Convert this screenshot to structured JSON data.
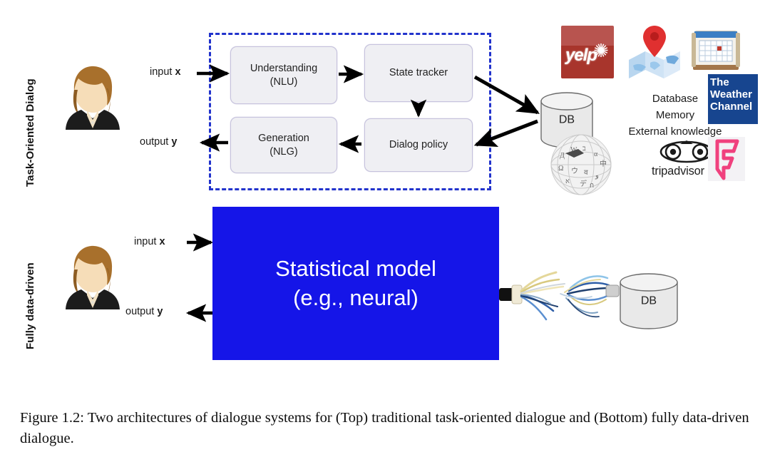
{
  "figure": {
    "rows": {
      "top_label": "Task-Oriented Dialog",
      "bottom_label": "Fully data-driven"
    },
    "io": {
      "input_label": "input ",
      "input_var": "x",
      "output_label": "output ",
      "output_var": "y"
    },
    "pipeline_boxes": [
      {
        "id": "nlu",
        "line1": "Understanding",
        "line2": "(NLU)"
      },
      {
        "id": "state",
        "line1": "State tracker",
        "line2": ""
      },
      {
        "id": "policy",
        "line1": "Dialog policy",
        "line2": ""
      },
      {
        "id": "nlg",
        "line1": "Generation",
        "line2": "(NLG)"
      }
    ],
    "model_box": {
      "line1": "Statistical model",
      "line2": "(e.g., neural)",
      "color": "#1515e8"
    },
    "databases": {
      "top_label": "DB",
      "bottom_label": "DB"
    },
    "knowledge_sources": {
      "line1": "Database",
      "line2": "Memory",
      "line3": "External knowledge"
    },
    "logos": {
      "yelp": "yelp",
      "maps": "map-pin-icon",
      "calendar": "calendar-icon",
      "weather": {
        "line1": "The",
        "line2": "Weather",
        "line3": "Channel"
      },
      "wikipedia": "wikipedia-globe-icon",
      "tripadvisor": "tripadvisor",
      "foursquare": "foursquare-icon"
    },
    "dashed_box_color": "#2233cc"
  },
  "caption": {
    "text": "Figure 1.2: Two architectures of dialogue systems for (Top) traditional task-oriented dialogue and (Bottom) fully data-driven dialogue."
  }
}
